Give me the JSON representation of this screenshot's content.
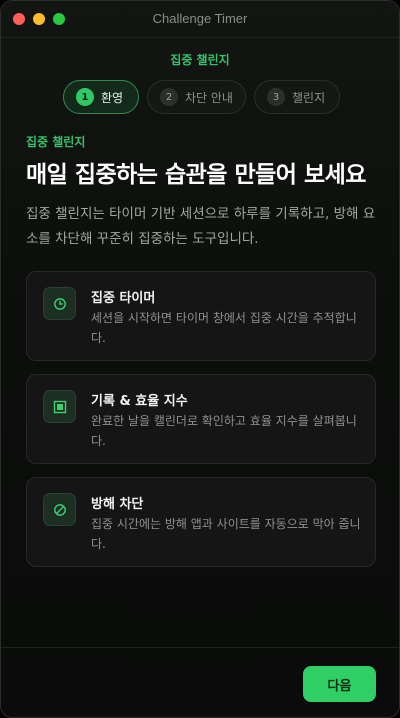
{
  "window": {
    "title": "Challenge Timer"
  },
  "header": {
    "step_title": "집중 챌린지"
  },
  "stepper": [
    {
      "number": "1",
      "label": "환영",
      "active": true
    },
    {
      "number": "2",
      "label": "차단 안내",
      "active": false
    },
    {
      "number": "3",
      "label": "챌린지",
      "active": false
    }
  ],
  "main": {
    "eyebrow": "집중 챌린지",
    "headline": "매일 집중하는 습관을 만들어 보세요",
    "description": "집중 챌린지는 타이머 기반 세션으로 하루를 기록하고, 방해 요소를 차단해 꾸준히 집중하는 도구입니다."
  },
  "features": [
    {
      "icon": "timer-icon",
      "title": "집중 타이머",
      "text": "세션을 시작하면 타이머 창에서 집중 시간을 추적합니다."
    },
    {
      "icon": "record-icon",
      "title": "기록 & 효율 지수",
      "text": "완료한 날을 캘린더로 확인하고 효율 지수를 살펴봅니다."
    },
    {
      "icon": "block-icon",
      "title": "방해 차단",
      "text": "집중 시간에는 방해 앱과 사이트를 자동으로 막아 줍니다."
    }
  ],
  "footer": {
    "next_label": "다음"
  },
  "colors": {
    "accent": "#35c16a",
    "button": "#2fcf66",
    "background": "#0c0e0c"
  }
}
